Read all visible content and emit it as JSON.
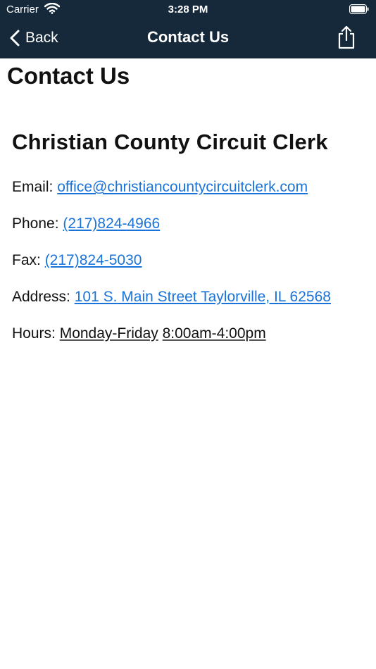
{
  "status_bar": {
    "carrier": "Carrier",
    "time": "3:28 PM"
  },
  "nav": {
    "back_label": "Back",
    "title": "Contact Us",
    "share_icon": "share-icon"
  },
  "page": {
    "title": "Contact Us",
    "organization": "Christian County Circuit Clerk",
    "email_label": "Email:",
    "email_value": "office@christiancountycircuitclerk.com",
    "phone_label": "Phone:",
    "phone_value": "(217)824-4966",
    "fax_label": "Fax:",
    "fax_value": "(217)824-5030",
    "address_label": "Address:",
    "address_value": "101 S. Main Street Taylorville, IL 62568",
    "hours_label": "Hours:",
    "hours_days": "Monday-Friday",
    "hours_time": "8:00am-4:00pm"
  },
  "colors": {
    "header_bg": "#15293a",
    "link": "#1a73d9"
  }
}
